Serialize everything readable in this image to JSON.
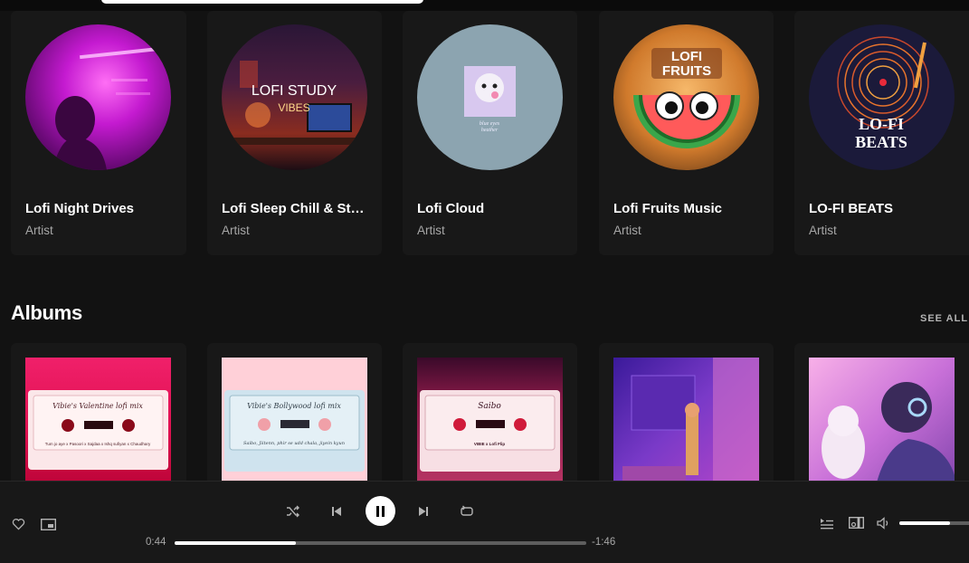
{
  "artists": [
    {
      "name": "Lofi Night Drives",
      "type": "Artist"
    },
    {
      "name": "Lofi Sleep Chill & Study",
      "type": "Artist",
      "cover_text": [
        "LOFI STUDY",
        "VIBES"
      ]
    },
    {
      "name": "Lofi Cloud",
      "type": "Artist",
      "cover_text": [
        "blue eyes",
        "heather"
      ]
    },
    {
      "name": "Lofi Fruits Music",
      "type": "Artist",
      "cover_text": [
        "LOFI",
        "FRUITS"
      ]
    },
    {
      "name": "LO-FI BEATS",
      "type": "Artist",
      "cover_text": [
        "LO-FI",
        "BEATS"
      ]
    }
  ],
  "albums_section": {
    "title": "Albums",
    "see_all": "SEE ALL"
  },
  "albums": [
    {
      "cassette_title": "Vibie's Valentine lofi mix",
      "cassette_sub": "Tum jo aye x Pasoori x Sajdaa x Ishq sufiyan x Chaudhary"
    },
    {
      "cassette_title": "Vibie's Bollywood lofi mix",
      "cassette_sub": "Saibo, Jiitenn, phir se udd chala, jiyein kyun"
    },
    {
      "cassette_title": "Saibo",
      "cassette_sub": "VIBIE x Lofi Flip"
    },
    {},
    {}
  ],
  "player": {
    "elapsed": "0:44",
    "remaining": "-1:46",
    "progress_percent": 29.5,
    "volume_percent": 62
  }
}
